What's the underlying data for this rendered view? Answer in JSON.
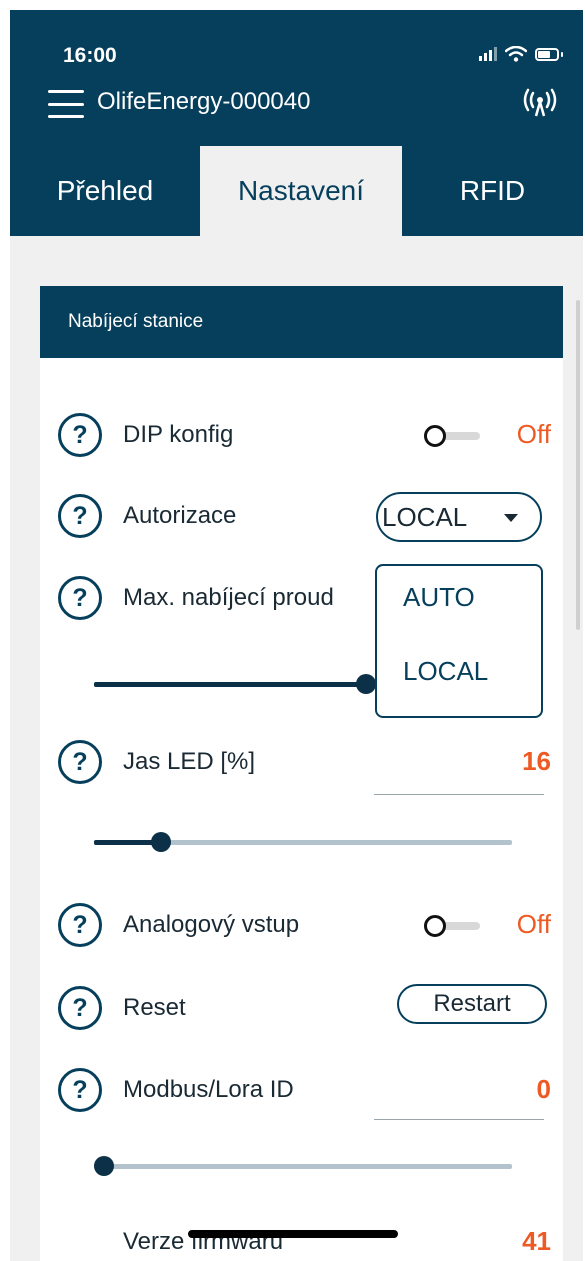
{
  "status_bar": {
    "time": "16:00"
  },
  "header": {
    "device_name": "OlifeEnergy-000040"
  },
  "tabs": [
    {
      "label": "Přehled",
      "active": false
    },
    {
      "label": "Nastavení",
      "active": true
    },
    {
      "label": "RFID",
      "active": false
    }
  ],
  "card": {
    "title": "Nabíjecí stanice"
  },
  "settings": {
    "dip": {
      "label": "DIP konfig",
      "state": "Off"
    },
    "auth": {
      "label": "Autorizace",
      "selected": "LOCAL",
      "options": [
        "AUTO",
        "LOCAL"
      ]
    },
    "max_current": {
      "label": "Max. nabíjecí proud"
    },
    "led": {
      "label": "Jas LED [%]",
      "value": "16"
    },
    "analog": {
      "label": "Analogový vstup",
      "state": "Off"
    },
    "reset": {
      "label": "Reset",
      "button": "Restart"
    },
    "modbus": {
      "label": "Modbus/Lora ID",
      "value": "0"
    },
    "firmware": {
      "label": "Verze firmwaru",
      "value": "41"
    }
  },
  "sliders": {
    "max_current_fraction": 0.65,
    "led_fraction": 0.16,
    "modbus_fraction": 0.0
  },
  "colors": {
    "primary": "#063f5c",
    "accent": "#ee5a24",
    "background": "#f0f0f0"
  },
  "icons": [
    "menu-icon",
    "antenna-icon",
    "help-icon",
    "signal-icon",
    "wifi-icon",
    "battery-icon"
  ]
}
